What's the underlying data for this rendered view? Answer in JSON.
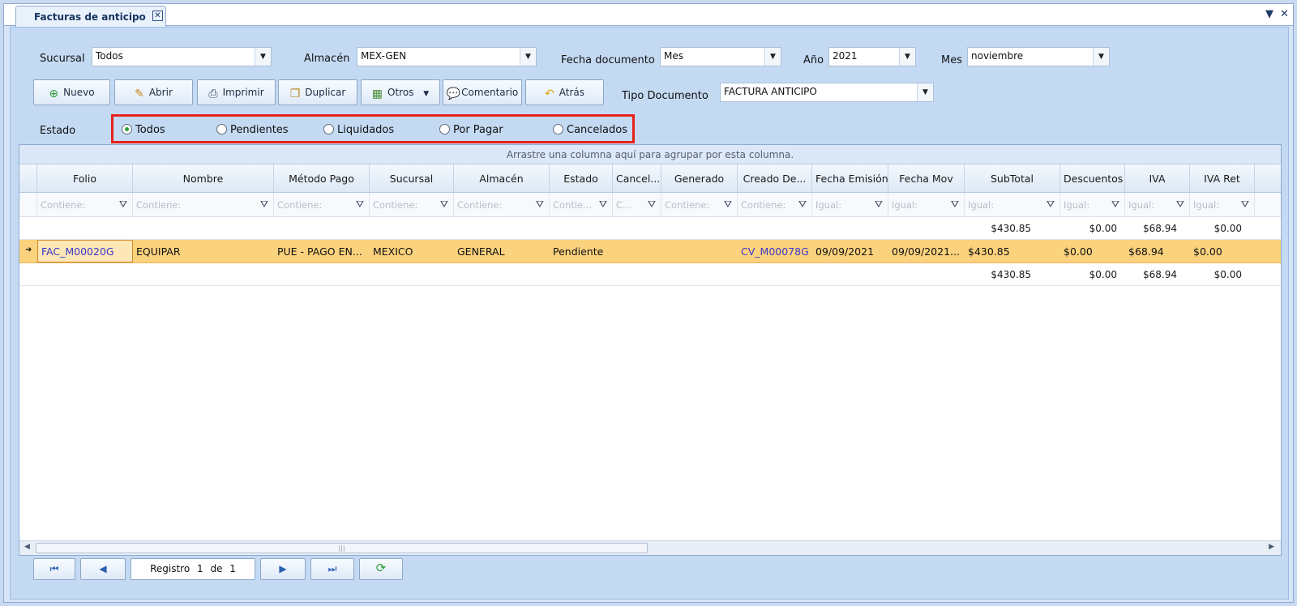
{
  "tab": {
    "title": "Facturas de anticipo",
    "close": "✕"
  },
  "window": {
    "menu": "▼",
    "close": "✕"
  },
  "filters": {
    "sucursal": {
      "label": "Sucursal",
      "value": "Todos"
    },
    "almacen": {
      "label": "Almacén",
      "value": "MEX-GEN"
    },
    "fecha_documento": {
      "label": "Fecha documento",
      "value": "Mes"
    },
    "anio": {
      "label": "Año",
      "value": "2021"
    },
    "mes": {
      "label": "Mes",
      "value": "noviembre"
    },
    "tipo_documento": {
      "label": "Tipo Documento",
      "value": "FACTURA ANTICIPO"
    }
  },
  "toolbar": {
    "nuevo": "Nuevo",
    "abrir": "Abrir",
    "imprimir": "Imprimir",
    "duplicar": "Duplicar",
    "otros": "Otros",
    "comentario": "Comentario",
    "atras": "Atrás"
  },
  "estado": {
    "label": "Estado",
    "options": [
      "Todos",
      "Pendientes",
      "Liquidados",
      "Por Pagar",
      "Cancelados"
    ],
    "selected": "Todos"
  },
  "grid": {
    "group_hint": "Arrastre una columna aquí para agrupar por esta columna.",
    "columns": [
      "Folio",
      "Nombre",
      "Método Pago",
      "Sucursal",
      "Almacén",
      "Estado",
      "Cancel...",
      "Generado",
      "Creado De...",
      "Fecha Emisión",
      "Fecha Mov",
      "SubTotal",
      "Descuentos",
      "IVA",
      "IVA Ret"
    ],
    "filters": [
      "Contiene:",
      "Contiene:",
      "Contiene:",
      "Contiene:",
      "Contiene:",
      "Contie...",
      "C...",
      "Contiene:",
      "Contiene:",
      "Igual:",
      "Igual:",
      "Igual:",
      "Igual:",
      "Igual:",
      "Igual:"
    ],
    "group_summary": {
      "subtotal": "$430.85",
      "descuentos": "$0.00",
      "iva": "$68.94",
      "iva_ret": "$0.00"
    },
    "rows": [
      {
        "folio": "FAC_M00020G",
        "nombre": "EQUIPAR",
        "metodo_pago": "PUE - PAGO EN...",
        "sucursal": "MEXICO",
        "almacen": "GENERAL",
        "estado": "Pendiente",
        "cancel": "",
        "generado": "",
        "creado_de": "CV_M00078G",
        "fecha_emision": "09/09/2021",
        "fecha_mov": "09/09/2021...",
        "subtotal": "$430.85",
        "descuentos": "$0.00",
        "iva": "$68.94",
        "iva_ret": "$0.00"
      }
    ],
    "total_summary": {
      "subtotal": "$430.85",
      "descuentos": "$0.00",
      "iva": "$68.94",
      "iva_ret": "$0.00"
    }
  },
  "pager": {
    "registro": "Registro",
    "current": "1",
    "de": "de",
    "total": "1"
  },
  "colors": {
    "selected_row": "#fbd27e",
    "highlight_border": "#e8211c",
    "link": "#3c37c7"
  }
}
